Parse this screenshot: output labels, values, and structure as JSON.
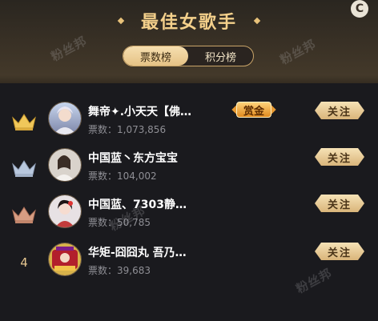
{
  "header": {
    "title": "最佳女歌手",
    "corner_icon": "C",
    "tabs": [
      {
        "label": "票数榜",
        "active": true
      },
      {
        "label": "积分榜",
        "active": false
      }
    ]
  },
  "watermark": "粉丝邦",
  "colors": {
    "gold": "#f4d08b",
    "background": "#1a1a1e",
    "gray_text": "#8f8f95"
  },
  "ranking": [
    {
      "rank": "1",
      "badge": "crown-gold-icon",
      "name": "舞帝✦.小天天【佛…",
      "votes": "票数：1,073,856",
      "reward": "赏金",
      "follow": "关注"
    },
    {
      "rank": "2",
      "badge": "crown-silver-icon",
      "name": "中国蓝丶东方宝宝",
      "votes": "票数：104,002",
      "follow": "关注"
    },
    {
      "rank": "3",
      "badge": "crown-bronze-icon",
      "name": "中国蓝、7303静…",
      "votes": "票数：50,785",
      "follow": "关注"
    },
    {
      "rank": "4",
      "badge": "",
      "name": "华矩-囧囧丸 吾乃…",
      "votes": "票数：39,683",
      "follow": "关注"
    }
  ]
}
